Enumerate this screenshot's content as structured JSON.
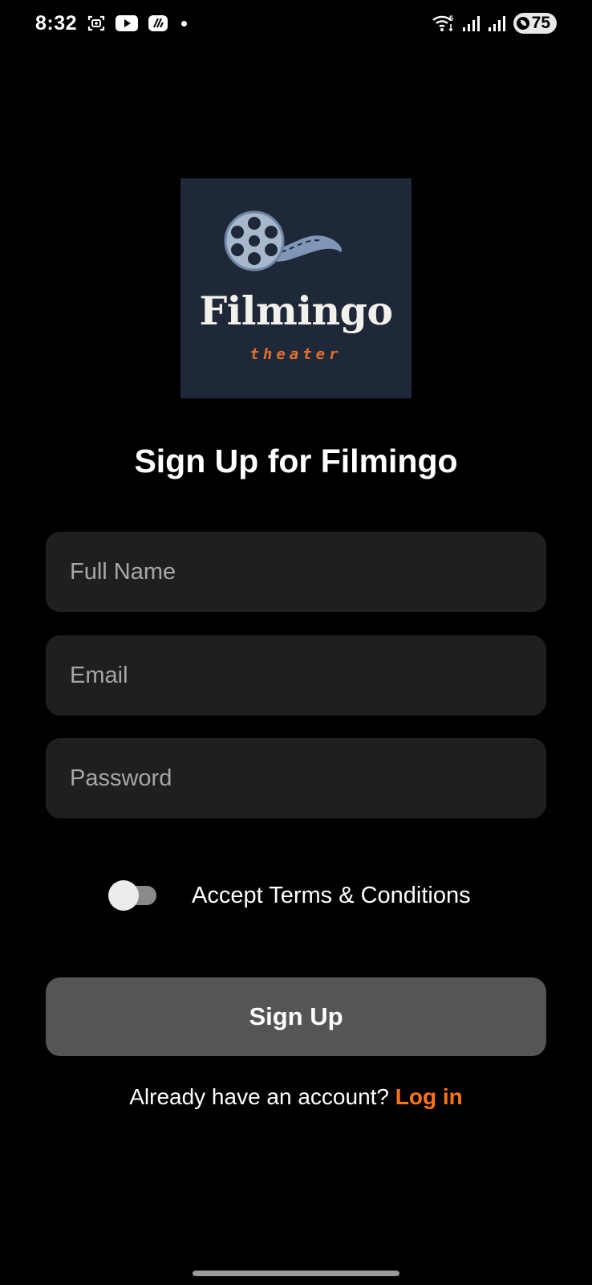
{
  "status_bar": {
    "time": "8:32",
    "battery": "75",
    "icons": [
      "screenshot-icon",
      "youtube-icon",
      "app-icon",
      "notification-dot",
      "wifi-icon",
      "signal-icon",
      "signal-icon"
    ]
  },
  "logo": {
    "wordmark": "Filmingo",
    "subtitle": "theater",
    "accent_color": "#e0702b",
    "background_color": "#1f2838"
  },
  "title": "Sign Up for Filmingo",
  "form": {
    "full_name_placeholder": "Full Name",
    "email_placeholder": "Email",
    "password_placeholder": "Password",
    "terms_label": "Accept Terms & Conditions",
    "terms_accepted": false,
    "submit_label": "Sign Up"
  },
  "footer": {
    "prompt": "Already have an account?",
    "login_link": "Log in",
    "link_color": "#ff7417"
  }
}
